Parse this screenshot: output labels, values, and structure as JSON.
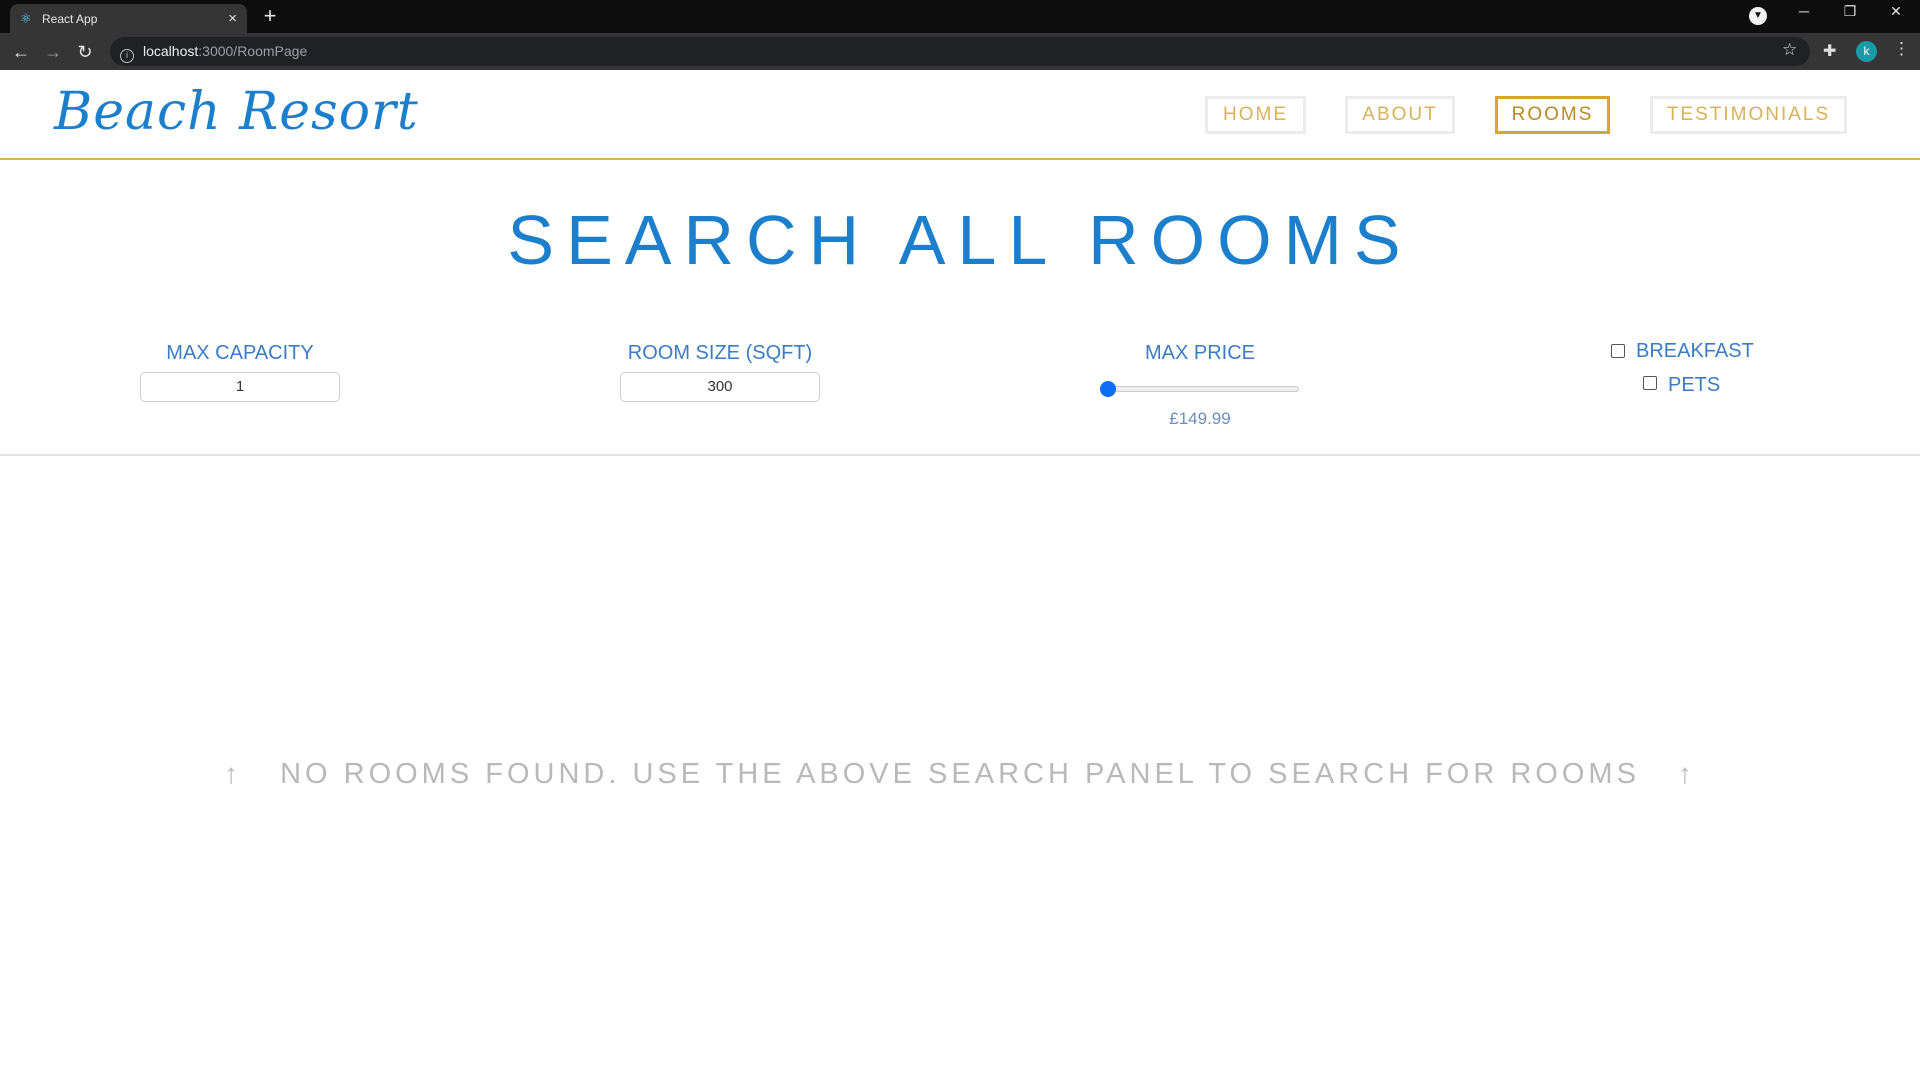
{
  "browser": {
    "tab_title": "React App",
    "url_host": "localhost",
    "url_path": ":3000/RoomPage",
    "profile_initial": "k"
  },
  "site": {
    "logo": "Beach Resort",
    "nav": [
      {
        "label": "HOME",
        "active": false
      },
      {
        "label": "ABOUT",
        "active": false
      },
      {
        "label": "ROOMS",
        "active": true
      },
      {
        "label": "TESTIMONIALS",
        "active": false
      }
    ]
  },
  "search": {
    "title": "SEARCH ALL ROOMS",
    "max_capacity_label": "MAX CAPACITY",
    "max_capacity_value": "1",
    "room_size_label": "ROOM SIZE (SQFT)",
    "room_size_value": "300",
    "max_price_label": "MAX PRICE",
    "max_price_value": "£149.99",
    "max_price_slider_fraction": 0.0,
    "breakfast_label": "BREAKFAST",
    "breakfast_checked": false,
    "pets_label": "PETS",
    "pets_checked": false
  },
  "results": {
    "empty_message": "NO ROOMS FOUND. USE THE ABOVE SEARCH PANEL TO SEARCH FOR ROOMS"
  },
  "colors": {
    "brand_blue": "#1b7fcc",
    "accent_gold": "#d9a23c"
  }
}
